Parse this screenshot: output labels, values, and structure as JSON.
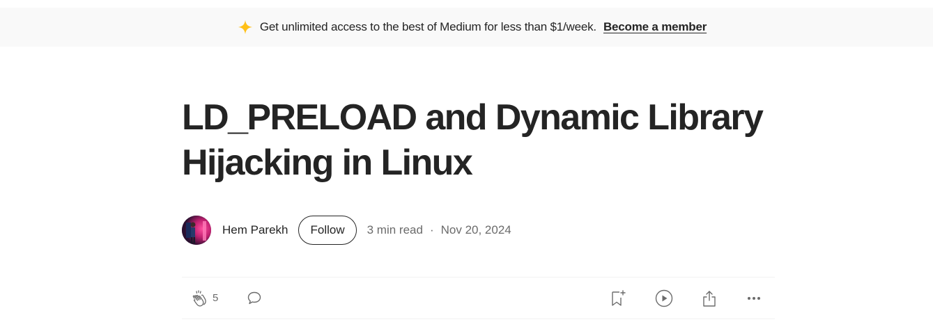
{
  "banner": {
    "promo_text": "Get unlimited access to the best of Medium for less than $1/week.",
    "member_link": "Become a member",
    "accent_color": "#ffc017",
    "icon": "sparkle-icon"
  },
  "article": {
    "title": "LD_PRELOAD and Dynamic Library Hijacking in Linux",
    "author": "Hem Parekh",
    "follow_label": "Follow",
    "read_time": "3 min read",
    "separator": "·",
    "date": "Nov 20, 2024"
  },
  "actions": {
    "clap_count": "5",
    "icons": [
      "clap-icon",
      "response-icon",
      "bookmark-add-icon",
      "listen-play-icon",
      "share-icon",
      "more-icon"
    ]
  }
}
